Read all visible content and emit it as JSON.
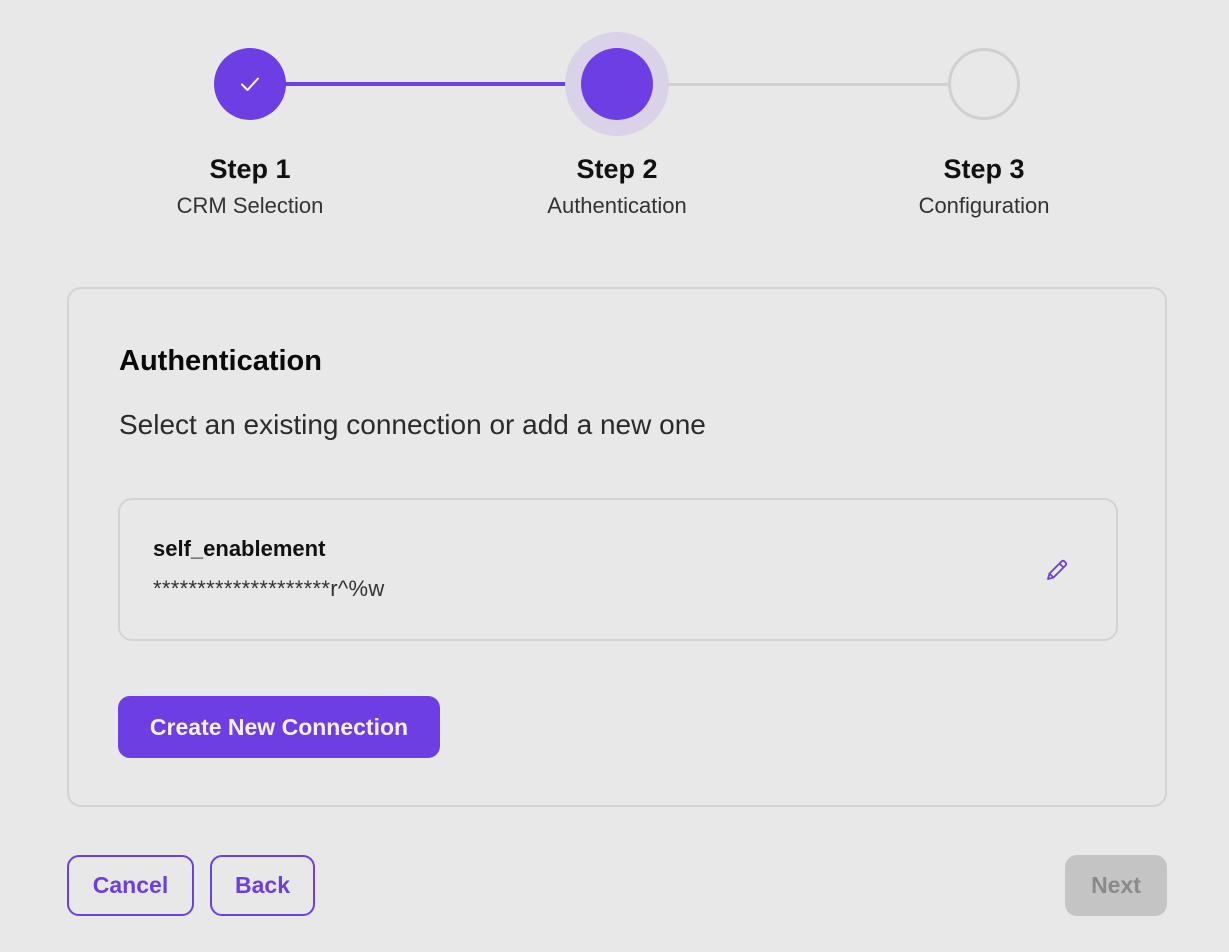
{
  "stepper": {
    "steps": [
      {
        "title": "Step 1",
        "subtitle": "CRM Selection",
        "state": "completed",
        "icon": "check-icon"
      },
      {
        "title": "Step 2",
        "subtitle": "Authentication",
        "state": "active"
      },
      {
        "title": "Step 3",
        "subtitle": "Configuration",
        "state": "pending"
      }
    ]
  },
  "card": {
    "title": "Authentication",
    "subtitle": "Select an existing connection or add a new one",
    "connections": [
      {
        "name": "self_enablement",
        "secret": "********************r^%w",
        "icon": "pencil-icon"
      }
    ],
    "create_label": "Create New Connection"
  },
  "footer": {
    "cancel_label": "Cancel",
    "back_label": "Back",
    "next_label": "Next",
    "next_disabled": true
  },
  "colors": {
    "accent": "#6d3ee3",
    "halo": "#d9d2e9",
    "background": "#e8e8e8",
    "border": "#d3d3d3",
    "disabled_bg": "#c4c4c4",
    "disabled_text": "#8a8a8a"
  }
}
